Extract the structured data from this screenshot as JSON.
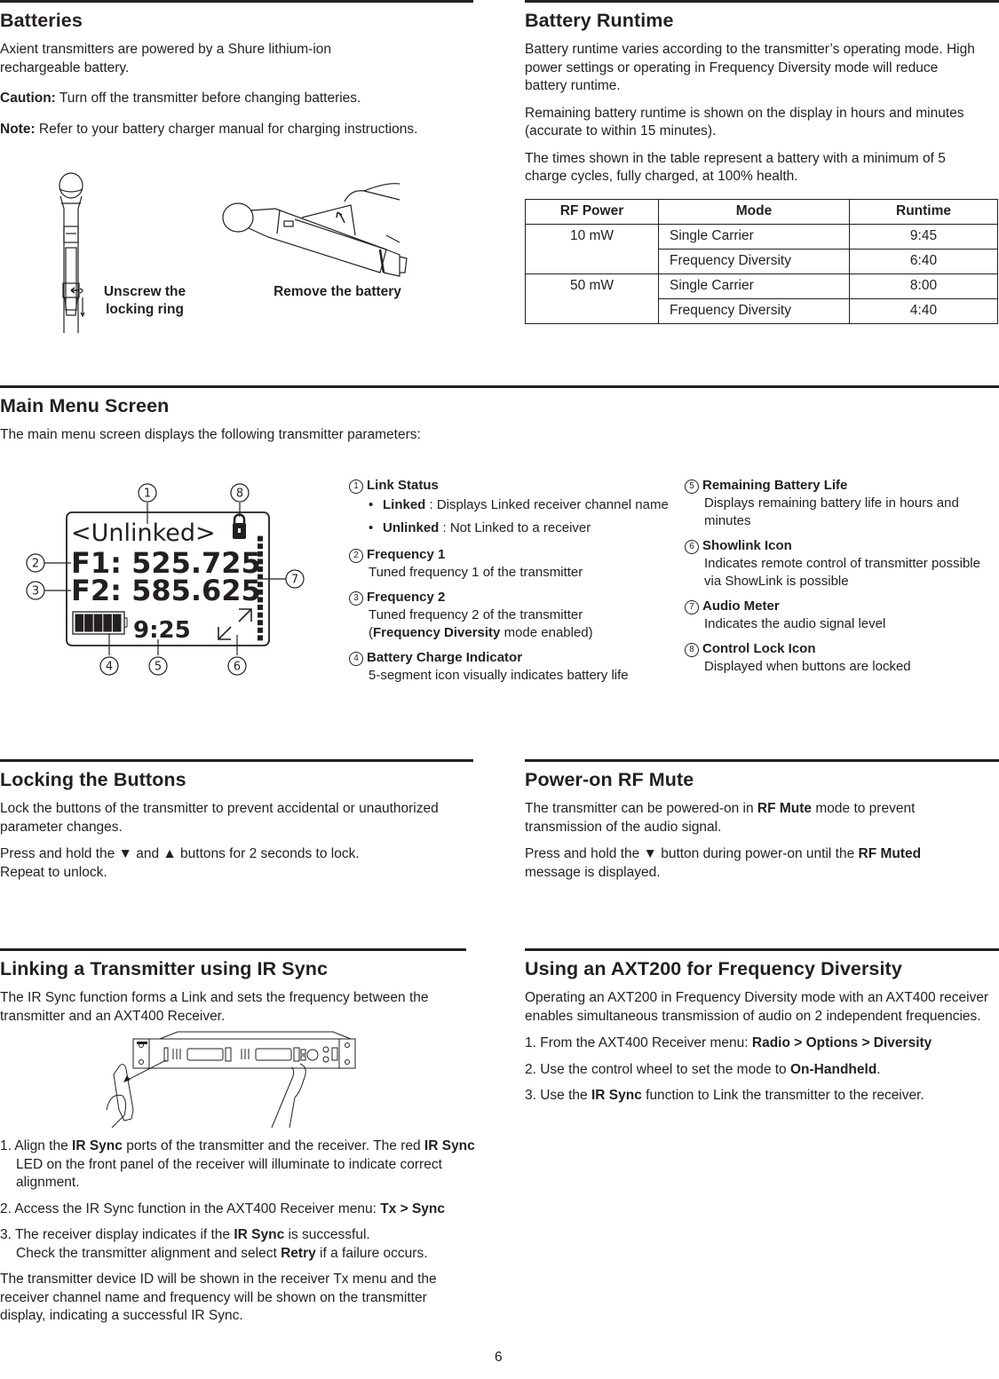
{
  "page_number": "6",
  "batteries": {
    "title": "Batteries",
    "intro": "Axient transmitters are powered by a Shure lithium-ion rechargeable battery.",
    "caution_label": "Caution:",
    "caution_text": " Turn off the transmitter before changing batteries.",
    "note_label": "Note:",
    "note_text": " Refer to your battery charger manual for charging instructions.",
    "figure_labels": {
      "unscrew_line1": "Unscrew the",
      "unscrew_line2": "locking ring",
      "remove": "Remove the battery"
    }
  },
  "battery_runtime": {
    "title": "Battery Runtime",
    "p1": "Battery runtime varies according to the transmitter’s operating mode. High power settings or operating in Frequency Diversity mode will reduce battery runtime.",
    "p2": "Remaining battery runtime is shown on the display in hours and minutes (accurate to within 15 minutes).",
    "p3": "The times shown in the table represent a battery with a minimum of 5 charge cycles, fully charged, at 100% health.",
    "table": {
      "headers": [
        "RF Power",
        "Mode",
        "Runtime"
      ],
      "rows": [
        {
          "power": "10 mW",
          "mode": "Single Carrier",
          "runtime": "9:45"
        },
        {
          "power": "",
          "mode": "Frequency Diversity",
          "runtime": "6:40"
        },
        {
          "power": "50 mW",
          "mode": "Single Carrier",
          "runtime": "8:00"
        },
        {
          "power": "",
          "mode": "Frequency Diversity",
          "runtime": "4:40"
        }
      ]
    }
  },
  "main_menu": {
    "title": "Main Menu Screen",
    "intro": "The main menu screen displays the following transmitter parameters:",
    "lcd": {
      "link": "<Unlinked>",
      "f1": "F1: 525.725",
      "f2": "F2: 585.625",
      "battery_time": "9:25",
      "battery_segments_filled": 5,
      "battery_segments_total": 5,
      "audio_meter_segments": 14,
      "callouts": [
        "1",
        "2",
        "3",
        "4",
        "5",
        "6",
        "7",
        "8"
      ]
    },
    "legend": [
      {
        "num": "1",
        "title": "Link Status",
        "bullets": [
          {
            "bold": "Linked",
            "text": " : Displays Linked receiver channel name"
          },
          {
            "bold": "Unlinked",
            "text": " : Not Linked to a receiver"
          }
        ]
      },
      {
        "num": "2",
        "title": "Frequency 1",
        "desc": "Tuned frequency 1 of the transmitter"
      },
      {
        "num": "3",
        "title": "Frequency 2",
        "desc": "Tuned frequency 2 of the transmitter",
        "desc2_pre": "(",
        "desc2_bold": "Frequency Diversity",
        "desc2_post": " mode enabled)"
      },
      {
        "num": "4",
        "title": "Battery Charge Indicator",
        "desc": "5-segment icon visually indicates battery life"
      },
      {
        "num": "5",
        "title": "Remaining Battery Life",
        "desc": "Displays remaining battery life in hours and minutes"
      },
      {
        "num": "6",
        "title": "Showlink Icon",
        "desc": "Indicates remote control of transmitter possible via ShowLink is possible"
      },
      {
        "num": "7",
        "title": "Audio Meter",
        "desc": "Indicates the audio signal level"
      },
      {
        "num": "8",
        "title": "Control Lock Icon",
        "desc": "Displayed when buttons are locked"
      }
    ]
  },
  "locking": {
    "title": "Locking the Buttons",
    "p1": "Lock the buttons of the transmitter to prevent accidental or unauthorized parameter changes.",
    "p2a": "Press and hold the ▼ and ▲ buttons for 2 seconds to lock.",
    "p2b": "Repeat to unlock."
  },
  "rf_mute": {
    "title": "Power-on RF Mute",
    "p1_pre": "The transmitter can be powered-on in ",
    "p1_bold": "RF Mute",
    "p1_post": " mode to prevent transmission of the audio signal.",
    "p2_pre": "Press and hold the ▼ button during power-on until the ",
    "p2_bold": "RF Muted",
    "p2_post": " message is displayed."
  },
  "ir_sync": {
    "title": "Linking a Transmitter using IR Sync",
    "intro": "The IR Sync function forms a Link and sets the frequency between the transmitter and an AXT400 Receiver.",
    "steps": [
      {
        "n": "1. ",
        "parts": [
          {
            "t": "Align the "
          },
          {
            "b": "IR Sync"
          },
          {
            "t": " ports of the transmitter and the receiver. The red "
          },
          {
            "b": "IR Sync"
          },
          {
            "t": " LED on the front panel of the receiver will illuminate to indicate correct alignment."
          }
        ]
      },
      {
        "n": "2. ",
        "parts": [
          {
            "t": "Access the IR Sync function in the AXT400 Receiver menu: "
          },
          {
            "b": "Tx > Sync"
          }
        ]
      },
      {
        "n": "3. ",
        "parts": [
          {
            "t": "The receiver display indicates if the "
          },
          {
            "b": "IR Sync"
          },
          {
            "t": " is successful."
          }
        ],
        "line2": [
          {
            "t": "Check the transmitter alignment and select "
          },
          {
            "b": "Retry"
          },
          {
            "t": " if a failure occurs."
          }
        ]
      }
    ],
    "outro": "The transmitter device ID will be shown in the receiver Tx menu and the receiver channel name and frequency will be shown on the transmitter display, indicating a successful IR Sync."
  },
  "axt200": {
    "title": "Using an AXT200 for Frequency Diversity",
    "intro": "Operating an AXT200 in Frequency Diversity mode with an AXT400 receiver enables simultaneous transmission of audio on 2 independent frequencies.",
    "steps": [
      {
        "n": "1. ",
        "parts": [
          {
            "t": "From the AXT400 Receiver menu: "
          },
          {
            "b": "Radio > Options > Diversity"
          }
        ]
      },
      {
        "n": "2. ",
        "parts": [
          {
            "t": "Use the control wheel to set the mode to "
          },
          {
            "b": "On-Handheld"
          },
          {
            "t": "."
          }
        ]
      },
      {
        "n": "3. ",
        "parts": [
          {
            "t": "Use the "
          },
          {
            "b": "IR Sync"
          },
          {
            "t": " function to Link the transmitter to the receiver."
          }
        ]
      }
    ]
  }
}
